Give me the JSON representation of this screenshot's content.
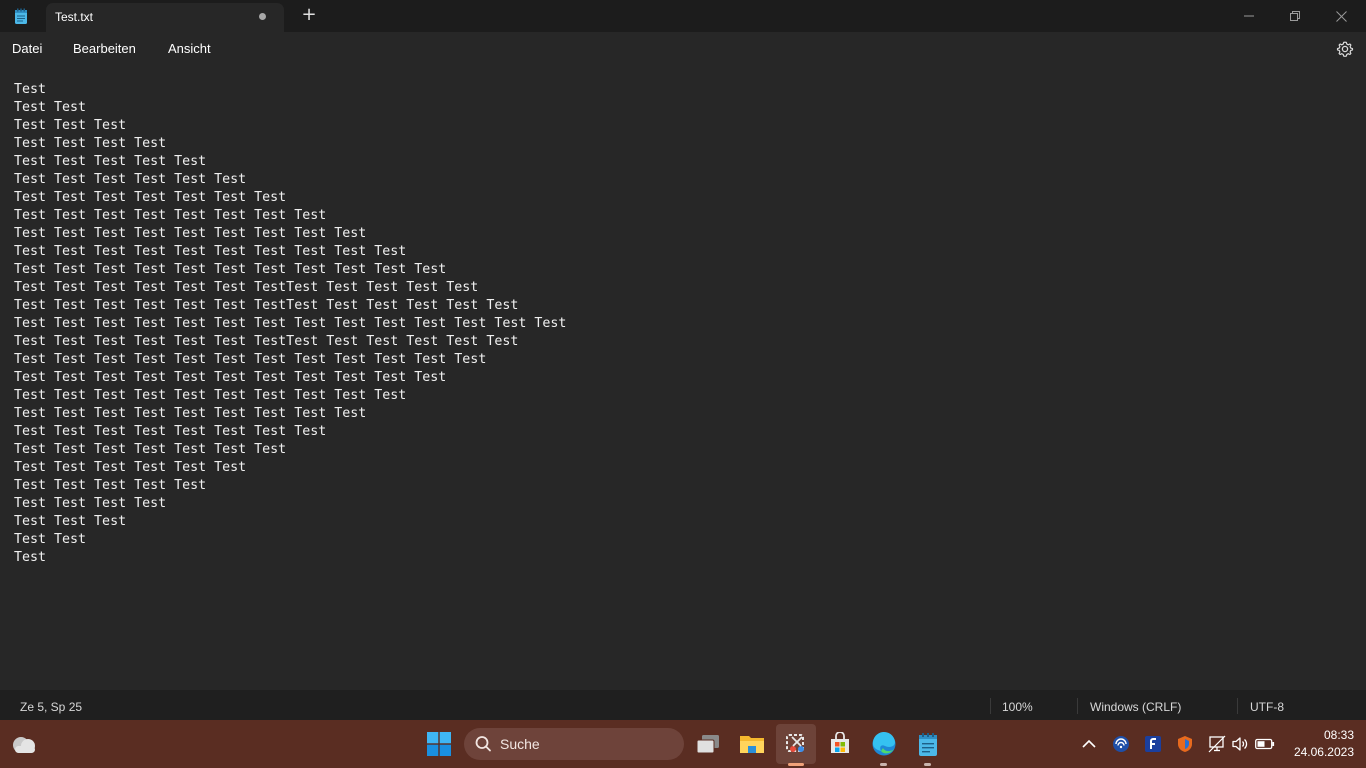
{
  "window": {
    "tab_title": "Test.txt",
    "new_tab_label": "+"
  },
  "menu": {
    "file": "Datei",
    "edit": "Bearbeiten",
    "view": "Ansicht"
  },
  "editor": {
    "lines": [
      "Test",
      "Test Test",
      "Test Test Test",
      "Test Test Test Test",
      "Test Test Test Test Test",
      "Test Test Test Test Test Test",
      "Test Test Test Test Test Test Test",
      "Test Test Test Test Test Test Test Test",
      "Test Test Test Test Test Test Test Test Test",
      "Test Test Test Test Test Test Test Test Test Test",
      "Test Test Test Test Test Test Test Test Test Test Test",
      "Test Test Test Test Test Test TestTest Test Test Test Test",
      "Test Test Test Test Test Test TestTest Test Test Test Test Test",
      "Test Test Test Test Test Test Test Test Test Test Test Test Test Test",
      "Test Test Test Test Test Test TestTest Test Test Test Test Test",
      "Test Test Test Test Test Test Test Test Test Test Test Test",
      "Test Test Test Test Test Test Test Test Test Test Test",
      "Test Test Test Test Test Test Test Test Test Test",
      "Test Test Test Test Test Test Test Test Test",
      "Test Test Test Test Test Test Test Test",
      "Test Test Test Test Test Test Test",
      "Test Test Test Test Test Test",
      "Test Test Test Test Test",
      "Test Test Test Test",
      "Test Test Test",
      "Test Test",
      "Test"
    ]
  },
  "status": {
    "position": "Ze 5, Sp 25",
    "zoom": "100%",
    "line_ending": "Windows (CRLF)",
    "encoding": "UTF-8"
  },
  "taskbar": {
    "search_label": "Suche",
    "time": "08:33",
    "date": "24.06.2023",
    "icons": [
      "weather-icon",
      "start-icon",
      "search-icon",
      "task-view-icon",
      "file-explorer-icon",
      "snipping-tool-icon",
      "store-icon",
      "edge-icon",
      "notepad-icon"
    ],
    "tray_icons": [
      "chevron-up-icon",
      "wifi-app-icon",
      "f-app-icon",
      "vpn-shield-icon",
      "network-icon",
      "volume-icon",
      "battery-icon"
    ]
  },
  "colors": {
    "taskbar_bg": "#5a2d22",
    "editor_bg": "#272727",
    "titlebar_bg": "#1c1c1c",
    "statusbar_bg": "#1f1f1f"
  }
}
